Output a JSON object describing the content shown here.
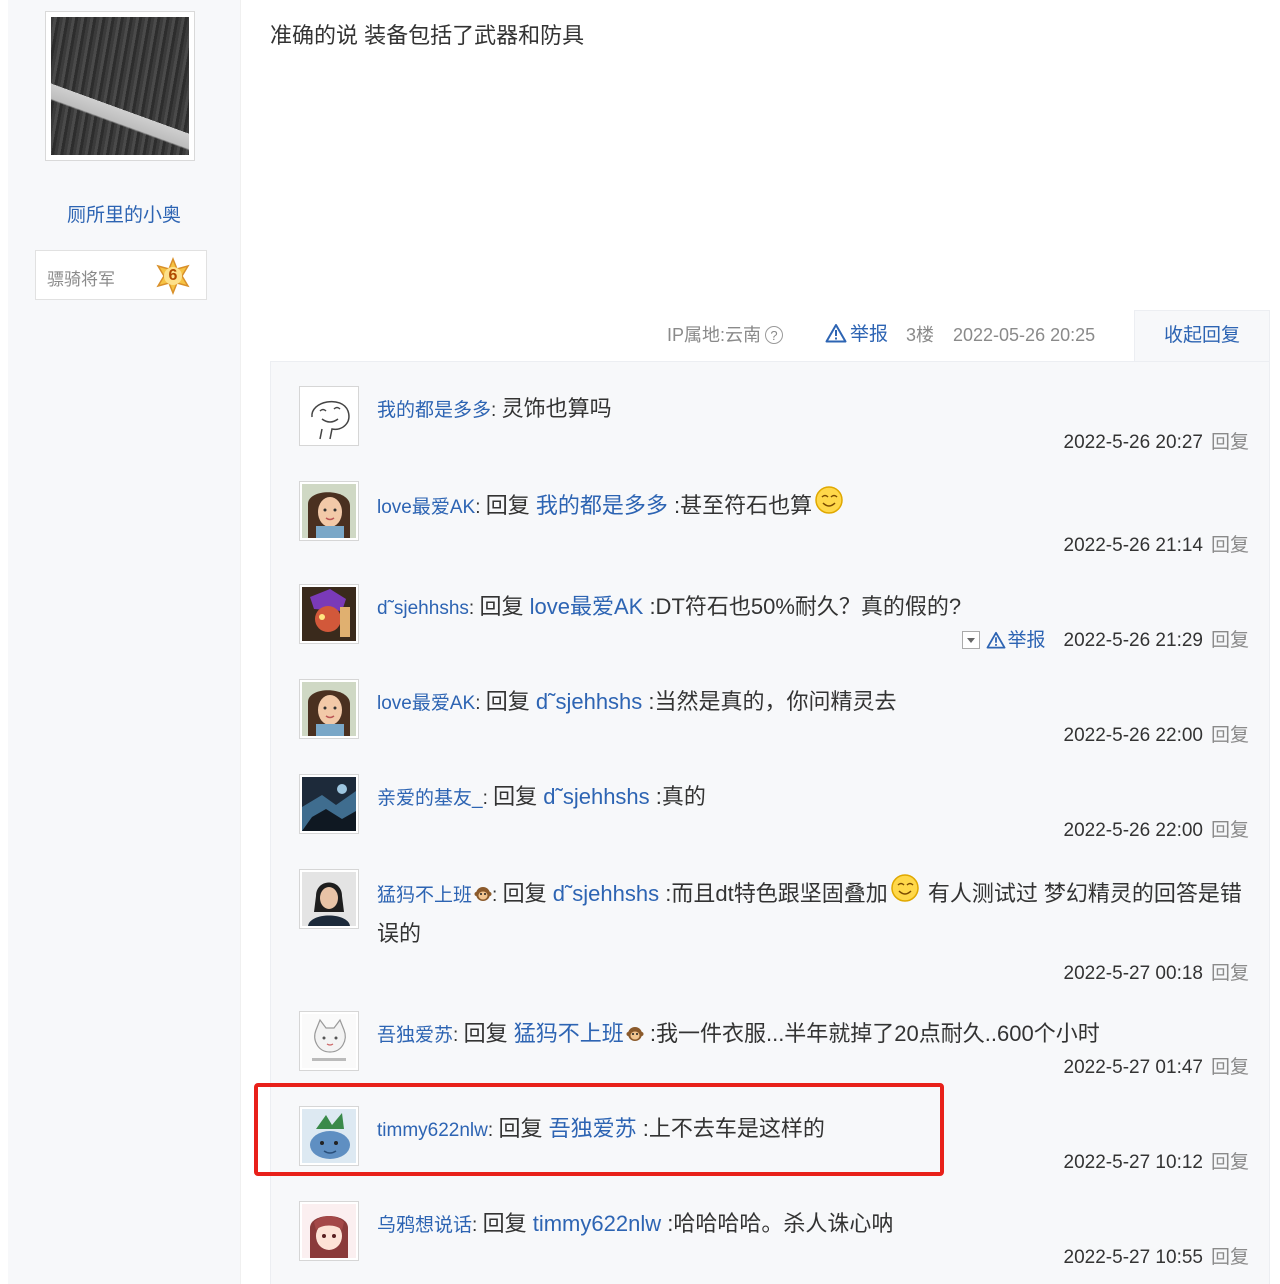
{
  "author": {
    "name": "厕所里的小奥",
    "level_title": "骠骑将军",
    "level_number": "6"
  },
  "post": {
    "content": "准确的说 装备包括了武器和防具",
    "ip_location": "IP属地:云南",
    "report_label": "举报",
    "floor": "3楼",
    "time": "2022-05-26 20:25",
    "collapse_label": "收起回复"
  },
  "replies": [
    {
      "user": "我的都是多多",
      "reply_word": "",
      "target": "",
      "text": "灵饰也算吗",
      "time": "2022-5-26 20:27",
      "reply_label": "回复"
    },
    {
      "user": "love最爱AK",
      "reply_word": "回复",
      "target": "我的都是多多",
      "text": ":甚至符石也算",
      "time": "2022-5-26 21:14",
      "reply_label": "回复"
    },
    {
      "user": "d˜sjehhshs",
      "reply_word": "回复",
      "target": "love最爱AK",
      "text": ":DT符石也50%耐久？真的假的?",
      "time": "2022-5-26 21:29",
      "reply_label": "回复",
      "report_label": "举报"
    },
    {
      "user": "love最爱AK",
      "reply_word": "回复",
      "target": "d˜sjehhshs",
      "text": ":当然是真的，你问精灵去",
      "time": "2022-5-26 22:00",
      "reply_label": "回复"
    },
    {
      "user": "亲爱的基友_",
      "reply_word": "回复",
      "target": "d˜sjehhshs",
      "text": ":真的",
      "time": "2022-5-26 22:00",
      "reply_label": "回复"
    },
    {
      "user": "猛犸不上班",
      "reply_word": "回复",
      "target": "d˜sjehhshs",
      "text": ":而且dt特色跟坚固叠加",
      "text2": " 有人测试过 梦幻精灵的回答是错误的",
      "time": "2022-5-27 00:18",
      "reply_label": "回复"
    },
    {
      "user": "吾独爱苏",
      "reply_word": "回复",
      "target": "猛犸不上班",
      "text": ":我一件衣服...半年就掉了20点耐久..600个小时",
      "time": "2022-5-27 01:47",
      "reply_label": "回复"
    },
    {
      "user": "timmy622nlw",
      "reply_word": "回复",
      "target": "吾独爱苏",
      "text": ":上不去车是这样的",
      "time": "2022-5-27 10:12",
      "reply_label": "回复"
    },
    {
      "user": "乌鸦想说话",
      "reply_word": "回复",
      "target": "timmy622nlw",
      "text": ":哈哈哈哈。杀人诛心呐",
      "time": "2022-5-27 10:55",
      "reply_label": "回复"
    }
  ],
  "colors": {
    "link": "#2d64b3",
    "highlight": "#e8201a",
    "reply_bg": "#f7f8fa"
  }
}
